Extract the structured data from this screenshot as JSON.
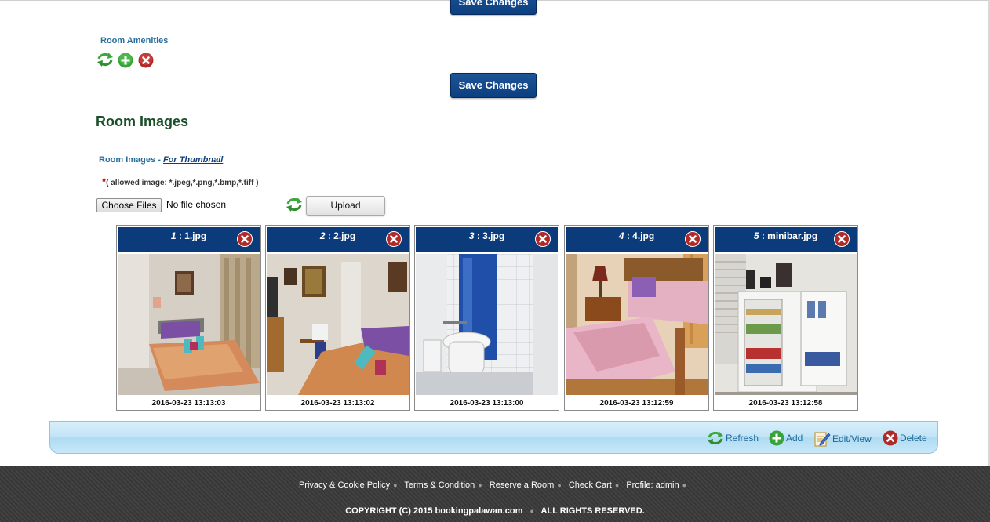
{
  "amenities": {
    "save_top_label": "Save Changes",
    "section_label": "Room Amenities",
    "save_label": "Save Changes",
    "icons": [
      "refresh-icon",
      "add-icon",
      "delete-icon"
    ]
  },
  "images_section": {
    "title": "Room Images",
    "label_prefix": "Room Images",
    "separator": "-",
    "thumbnail_link": "For Thumbnail",
    "required_mark": "*",
    "allowed_text": "( allowed image: *.jpeg,*.png,*.bmp,*.tiff )",
    "choose_files_label": "Choose Files",
    "no_file_text": "No file chosen",
    "upload_label": "Upload"
  },
  "images": [
    {
      "num": "1",
      "name": ": 1.jpg",
      "date": "2016-03-23 13:13:03"
    },
    {
      "num": "2",
      "name": ": 2.jpg",
      "date": "2016-03-23 13:13:02"
    },
    {
      "num": "3",
      "name": ": 3.jpg",
      "date": "2016-03-23 13:13:00"
    },
    {
      "num": "4",
      "name": ": 4.jpg",
      "date": "2016-03-23 13:12:59"
    },
    {
      "num": "5",
      "name": ": minibar.jpg",
      "date": "2016-03-23 13:12:58"
    }
  ],
  "toolbar": {
    "refresh": "Refresh",
    "add": "Add",
    "edit": "Edit/View",
    "delete": "Delete"
  },
  "footer": {
    "links": [
      "Privacy & Cookie Policy",
      "Terms & Condition",
      "Reserve a Room",
      "Check Cart",
      "Profile: admin"
    ],
    "copyright": "COPYRIGHT (C) 2015",
    "site": "bookingpalawan.com",
    "rights": "ALL RIGHTS RESERVED."
  },
  "colors": {
    "accent": "#0b3b7a",
    "heading": "#1b4f2a",
    "link": "#2a6f9d",
    "footer_bg": "#3a3a3a",
    "toolbar_bg": "#c2e4f6"
  }
}
